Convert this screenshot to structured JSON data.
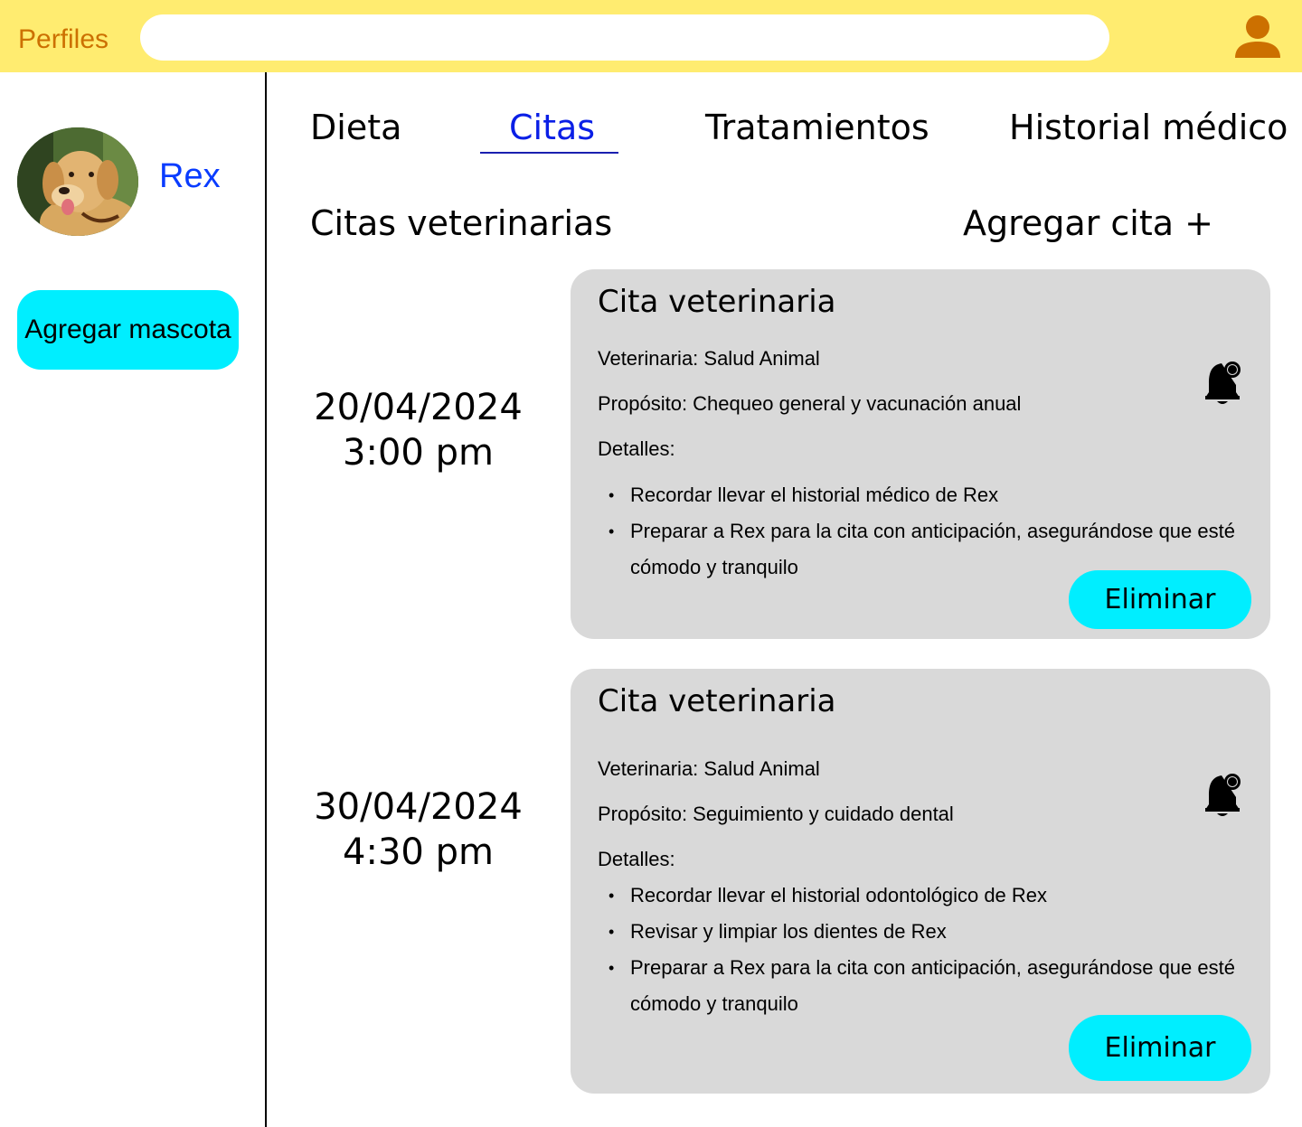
{
  "header": {
    "brand": "Perfiles",
    "search_placeholder": "",
    "user_icon": "user-icon"
  },
  "sidebar": {
    "pet_name": "Rex",
    "add_pet_label": "Agregar mascota"
  },
  "tabs": [
    {
      "label": "Dieta"
    },
    {
      "label": "Citas",
      "active": true
    },
    {
      "label": "Tratamientos"
    },
    {
      "label": "Historial médico"
    }
  ],
  "main": {
    "section_title": "Citas veterinarias",
    "add_label": "Agregar cita +"
  },
  "appointments": [
    {
      "date": "20/04/2024",
      "time": "3:00 pm",
      "title": "Cita veterinaria",
      "vet": "Veterinaria: Salud Animal",
      "purpose": "Propósito: Chequeo general y vacunación anual",
      "details_label": "Detalles:",
      "details": [
        "Recordar llevar el historial médico de Rex",
        "Preparar a Rex para la cita con anticipación, asegurándose que esté cómodo y tranquilo"
      ],
      "delete_label": "Eliminar"
    },
    {
      "date": "30/04/2024",
      "time": "4:30 pm",
      "title": "Cita veterinaria",
      "vet": "Veterinaria: Salud Animal",
      "purpose": "Propósito: Seguimiento y cuidado dental",
      "details_label": "Detalles:",
      "details": [
        "Recordar llevar el historial odontológico de Rex",
        "Revisar y limpiar los dientes de Rex",
        "Preparar a Rex para la cita con anticipación, asegurándose que esté cómodo y tranquilo"
      ],
      "delete_label": "Eliminar"
    }
  ],
  "colors": {
    "topbar": "#ffec70",
    "brand": "#cc7000",
    "accent_button": "#00eeff",
    "card": "#d9d9d9",
    "active_tab": "#0a1fe6",
    "pet_name": "#0a3cff"
  }
}
